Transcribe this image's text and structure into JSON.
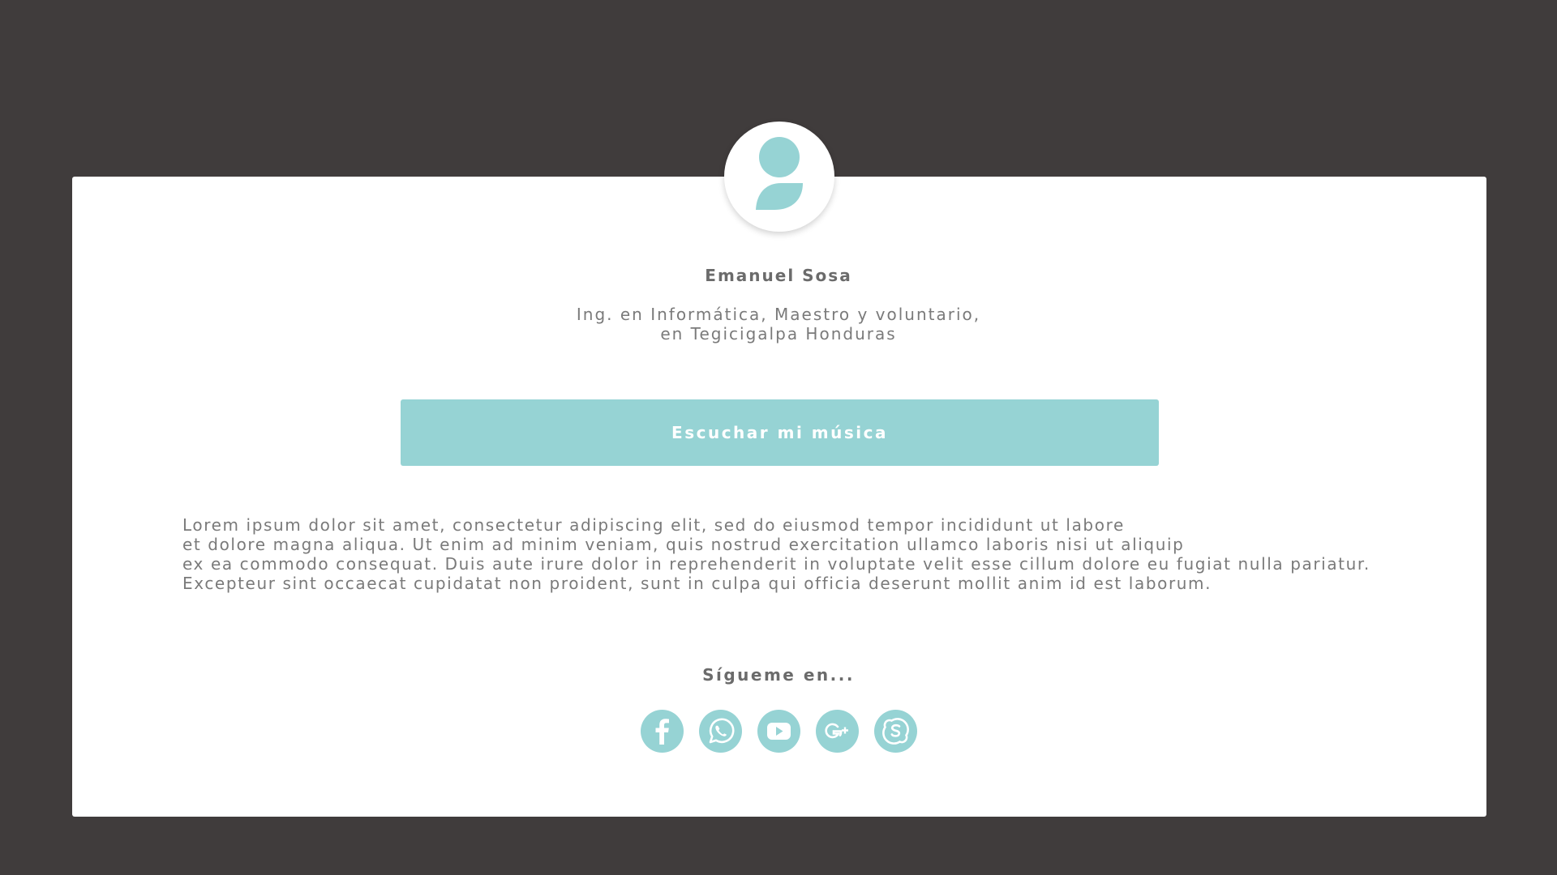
{
  "colors": {
    "background": "#403c3c",
    "card": "#ffffff",
    "accent": "#96d3d4",
    "text": "#7a7a7a"
  },
  "profile": {
    "avatar_icon": "user-avatar-icon",
    "name": "Emanuel Sosa",
    "subtitle_lines": [
      "Ing. en Informática, Maestro y voluntario,",
      "en Tegicigalpa Honduras"
    ]
  },
  "cta": {
    "label": "Escuchar mi música"
  },
  "bio": {
    "lines": [
      "Lorem ipsum dolor sit amet, consectetur adipiscing elit, sed do eiusmod tempor incididunt ut labore",
      "et dolore magna aliqua. Ut enim ad minim veniam, quis nostrud exercitation ullamco laboris nisi ut aliquip",
      "ex ea commodo consequat. Duis aute irure dolor in reprehenderit in voluptate velit esse cillum dolore eu fugiat nulla pariatur.",
      "Excepteur sint occaecat cupidatat non proident, sunt in culpa qui officia deserunt mollit anim id est laborum."
    ]
  },
  "follow": {
    "label": "Sígueme en...",
    "icons": [
      "facebook-icon",
      "whatsapp-icon",
      "youtube-icon",
      "google-plus-icon",
      "skype-icon"
    ]
  }
}
